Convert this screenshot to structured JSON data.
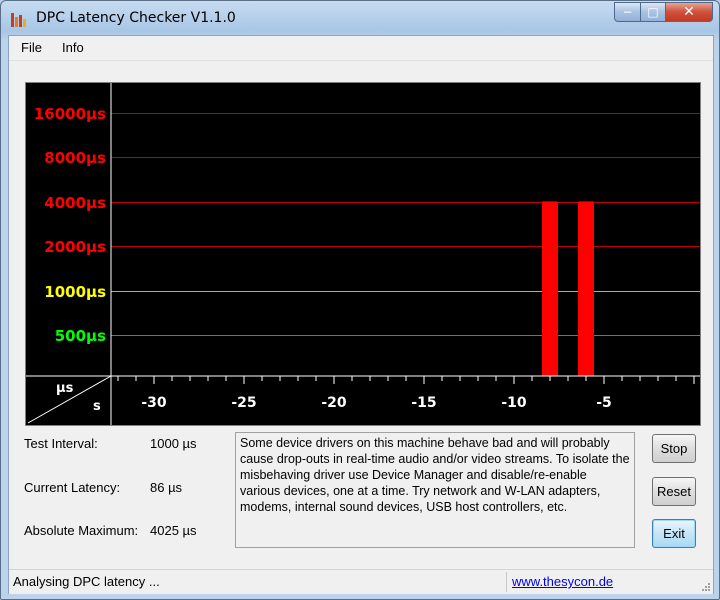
{
  "window": {
    "title": "DPC Latency Checker V1.1.0",
    "buttons": {
      "minimize": "−",
      "maximize": "□",
      "close": "✕"
    }
  },
  "menu": {
    "items": [
      "File",
      "Info"
    ]
  },
  "chart": {
    "y_tick_labels": [
      "16000µs",
      "8000µs",
      "4000µs",
      "2000µs",
      "1000µs",
      "500µs"
    ],
    "y_tick_colors": [
      "#ff0000",
      "#ff0000",
      "#ff0000",
      "#ff0000",
      "#ffff00",
      "#00ff00"
    ],
    "x_tick_labels": [
      "-30",
      "-25",
      "-20",
      "-15",
      "-10",
      "-5"
    ],
    "corner_unit_y": "µs",
    "corner_unit_x": "s"
  },
  "chart_data": {
    "type": "bar",
    "x_unit": "s",
    "y_unit": "µs",
    "y_scale": "log",
    "x": [
      -29,
      -28,
      -27,
      -26,
      -25,
      -24,
      -23,
      -22,
      -21,
      -20,
      -19,
      -18,
      -17,
      -16,
      -15,
      -14,
      -13,
      -12,
      -11,
      -10,
      -9,
      -8,
      -7,
      -6,
      -5,
      -4,
      -3,
      -2,
      -1,
      0
    ],
    "values": [
      80,
      80,
      80,
      90,
      80,
      80,
      80,
      80,
      90,
      80,
      90,
      80,
      80,
      80,
      100,
      90,
      90,
      110,
      80,
      90,
      170,
      4025,
      220,
      4025,
      180,
      70,
      70,
      80,
      170,
      80
    ],
    "thresholds": [
      {
        "value": 500,
        "color": "#00c000"
      },
      {
        "value": 1000,
        "color": "#c0c000"
      },
      {
        "value": 2000,
        "color": "#c00000"
      },
      {
        "value": 4000,
        "color": "#c00000"
      },
      {
        "value": 8000,
        "color": "#c00000"
      },
      {
        "value": 16000,
        "color": "#c00000"
      }
    ],
    "bar_color_normal": "#00ff00",
    "bar_color_high": "#ff0000"
  },
  "stats": {
    "test_interval_label": "Test Interval:",
    "test_interval_value": "1000 µs",
    "current_latency_label": "Current Latency:",
    "current_latency_value": "86 µs",
    "absolute_max_label": "Absolute Maximum:",
    "absolute_max_value": "4025 µs"
  },
  "message": "Some device drivers on this machine behave bad and will probably cause drop-outs in real-time audio and/or video streams. To isolate the misbehaving driver use Device Manager and disable/re-enable various devices, one at a time. Try network and W-LAN adapters, modems, internal sound devices, USB host controllers, etc.",
  "buttons": {
    "stop": "Stop",
    "reset": "Reset",
    "exit": "Exit"
  },
  "status": {
    "text": "Analysing DPC latency ...",
    "link": "www.thesycon.de"
  }
}
